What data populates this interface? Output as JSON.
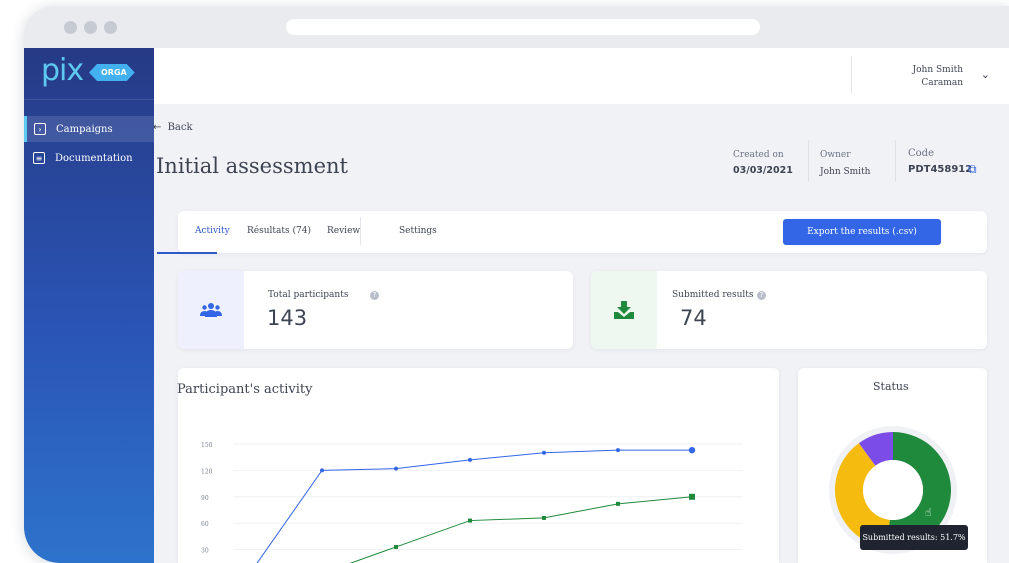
{
  "app": {
    "logo": "pix",
    "badge": "ORGA"
  },
  "sidebar": {
    "items": [
      {
        "label": "Campaigns",
        "icon": "chevron-right-square-icon",
        "active": true
      },
      {
        "label": "Documentation",
        "icon": "document-icon",
        "active": false
      }
    ]
  },
  "header": {
    "user_name": "John Smith",
    "user_org": "Caraman"
  },
  "campaign": {
    "back_label": "Back",
    "title": "Initial assessment",
    "created_label": "Created on",
    "created_value": "03/03/2021",
    "owner_label": "Owner",
    "owner_value": "John Smith",
    "code_label": "Code",
    "code_value": "PDT458912"
  },
  "tabs": [
    {
      "label": "Activity",
      "active": true
    },
    {
      "label": "Résultats (74)",
      "active": false
    },
    {
      "label": "Review",
      "active": false
    },
    {
      "label": "Settings",
      "active": false
    }
  ],
  "export_label": "Export the results (.csv)",
  "stats": [
    {
      "label": "Total participants",
      "value": "143",
      "icon": "users-icon",
      "color": "#3266e6",
      "bg": "#eef1fd"
    },
    {
      "label": "Submitted results",
      "value": "74",
      "icon": "download-tray-icon",
      "color": "#1f8a3b",
      "bg": "#eef7f0"
    }
  ],
  "activity_title": "Participant's activity",
  "status_title": "Status",
  "tooltip_text": "Submitted results: 51.7%",
  "colors": {
    "primary": "#3266e6",
    "green": "#1f8a3b",
    "yellow": "#f6bb0f",
    "purple": "#7c4ce8"
  },
  "chart_data": [
    {
      "type": "line",
      "y_ticks": [
        "150",
        "120",
        "90",
        "60",
        "30"
      ],
      "ylim": [
        0,
        150
      ],
      "series": [
        {
          "color": "#3266e6",
          "marker": "circle",
          "values": [
            0,
            120,
            122,
            132,
            140,
            143,
            143
          ]
        },
        {
          "color": "#1f8a3b",
          "marker": "square",
          "values": [
            0,
            3,
            33,
            63,
            66,
            82,
            90
          ]
        }
      ]
    },
    {
      "type": "pie",
      "values": [
        51.7,
        38.3,
        10.0
      ],
      "colors": [
        "#1f8a3b",
        "#f6bb0f",
        "#7c4ce8"
      ]
    }
  ]
}
